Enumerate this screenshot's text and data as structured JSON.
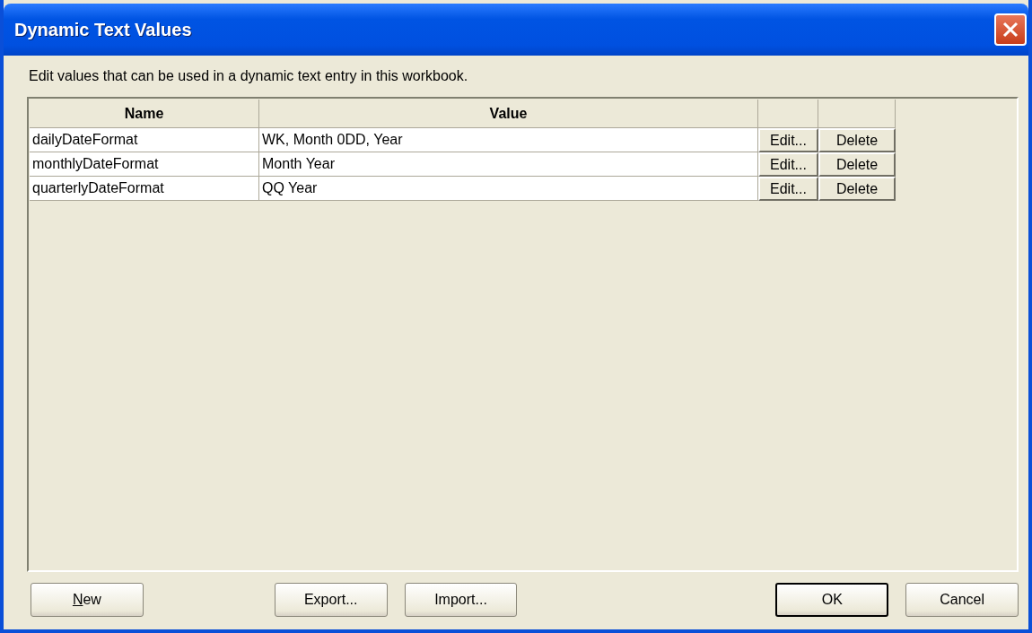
{
  "window": {
    "title": "Dynamic Text Values"
  },
  "description": "Edit values that can be used in a dynamic text entry in this workbook.",
  "table": {
    "columns": [
      "Name",
      "Value"
    ],
    "rows": [
      {
        "name": "dailyDateFormat",
        "value": "WK, Month 0DD, Year",
        "edit": "Edit...",
        "delete": "Delete"
      },
      {
        "name": "monthlyDateFormat",
        "value": "Month Year",
        "edit": "Edit...",
        "delete": "Delete"
      },
      {
        "name": "quarterlyDateFormat",
        "value": "QQ Year",
        "edit": "Edit...",
        "delete": "Delete"
      }
    ]
  },
  "buttons": {
    "left": [
      {
        "label": "New",
        "mnemonic": true,
        "default": false
      }
    ],
    "middle": [
      {
        "label": "Export...",
        "mnemonic": false,
        "default": false
      },
      {
        "label": "Import...",
        "mnemonic": false,
        "default": false
      }
    ],
    "right": [
      {
        "label": "OK",
        "mnemonic": false,
        "default": true
      },
      {
        "label": "Cancel",
        "mnemonic": false,
        "default": false
      }
    ]
  }
}
